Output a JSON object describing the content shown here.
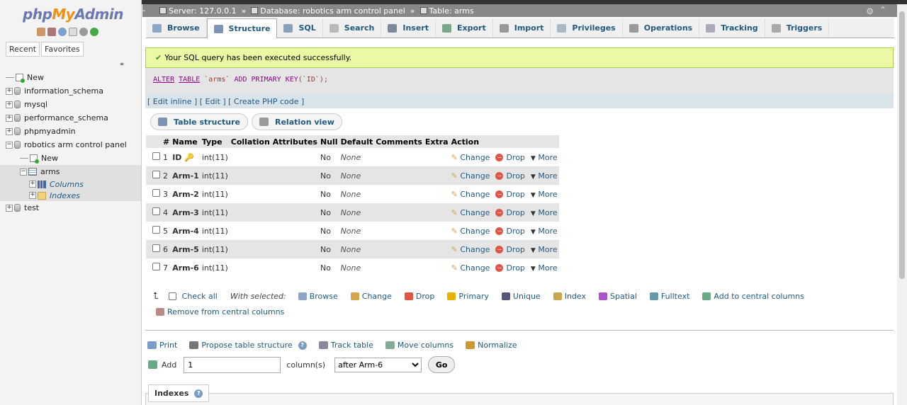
{
  "sidebar": {
    "logo": {
      "php": "php",
      "my": "My",
      "admin": "Admin"
    },
    "tabs": [
      "Recent",
      "Favorites"
    ],
    "tree": [
      {
        "label": "New",
        "type": "new",
        "level": 0
      },
      {
        "label": "information_schema",
        "type": "db",
        "level": 0
      },
      {
        "label": "mysql",
        "type": "db",
        "level": 0
      },
      {
        "label": "performance_schema",
        "type": "db",
        "level": 0
      },
      {
        "label": "phpmyadmin",
        "type": "db",
        "level": 0
      },
      {
        "label": "robotics arm control panel",
        "type": "db",
        "level": 0,
        "expanded": true
      },
      {
        "label": "New",
        "type": "new",
        "level": 1
      },
      {
        "label": "arms",
        "type": "table",
        "level": 1,
        "selected": true
      },
      {
        "label": "Columns",
        "type": "columns",
        "level": 2
      },
      {
        "label": "Indexes",
        "type": "indexes",
        "level": 2
      },
      {
        "label": "test",
        "type": "db",
        "level": 0
      }
    ]
  },
  "breadcrumb": {
    "server": "Server: 127.0.0.1",
    "sep": "»",
    "database": "Database: robotics arm control panel",
    "table": "Table: arms"
  },
  "tabs": [
    "Browse",
    "Structure",
    "SQL",
    "Search",
    "Insert",
    "Export",
    "Import",
    "Privileges",
    "Operations",
    "Tracking",
    "Triggers"
  ],
  "active_tab": "Structure",
  "message": {
    "success": "Your SQL query has been executed successfully.",
    "sql_alter": "ALTER",
    "sql_table": "TABLE",
    "sql_name": "`arms`",
    "sql_add": "ADD",
    "sql_pk": "PRIMARY KEY",
    "sql_rest": "(`ID`);",
    "links": "[ Edit inline ] [ Edit ] [ Create PHP code ]"
  },
  "subtabs": [
    "Table structure",
    "Relation view"
  ],
  "table": {
    "headers": [
      "",
      "#",
      "Name",
      "Type",
      "Collation",
      "Attributes",
      "Null",
      "Default",
      "Comments",
      "Extra",
      "Action"
    ],
    "rows": [
      {
        "num": "1",
        "name": "ID",
        "type": "int(11)",
        "null": "No",
        "default": "None",
        "key": true
      },
      {
        "num": "2",
        "name": "Arm-1",
        "type": "int(11)",
        "null": "No",
        "default": "None"
      },
      {
        "num": "3",
        "name": "Arm-2",
        "type": "int(11)",
        "null": "No",
        "default": "None"
      },
      {
        "num": "4",
        "name": "Arm-3",
        "type": "int(11)",
        "null": "No",
        "default": "None"
      },
      {
        "num": "5",
        "name": "Arm-4",
        "type": "int(11)",
        "null": "No",
        "default": "None"
      },
      {
        "num": "6",
        "name": "Arm-5",
        "type": "int(11)",
        "null": "No",
        "default": "None"
      },
      {
        "num": "7",
        "name": "Arm-6",
        "type": "int(11)",
        "null": "No",
        "default": "None"
      }
    ],
    "actions": {
      "change": "Change",
      "drop": "Drop",
      "more": "More"
    }
  },
  "bulk": {
    "check_all": "Check all",
    "with_selected": "With selected:",
    "items": [
      "Browse",
      "Change",
      "Drop",
      "Primary",
      "Unique",
      "Index",
      "Spatial",
      "Fulltext",
      "Add to central columns"
    ],
    "remove_central": "Remove from central columns"
  },
  "footer_actions": [
    "Print",
    "Propose table structure",
    "Track table",
    "Move columns",
    "Normalize"
  ],
  "add_column": {
    "label": "Add",
    "value": "1",
    "columns_label": "column(s)",
    "position": "after Arm-6",
    "go": "Go"
  },
  "indexes_label": "Indexes"
}
